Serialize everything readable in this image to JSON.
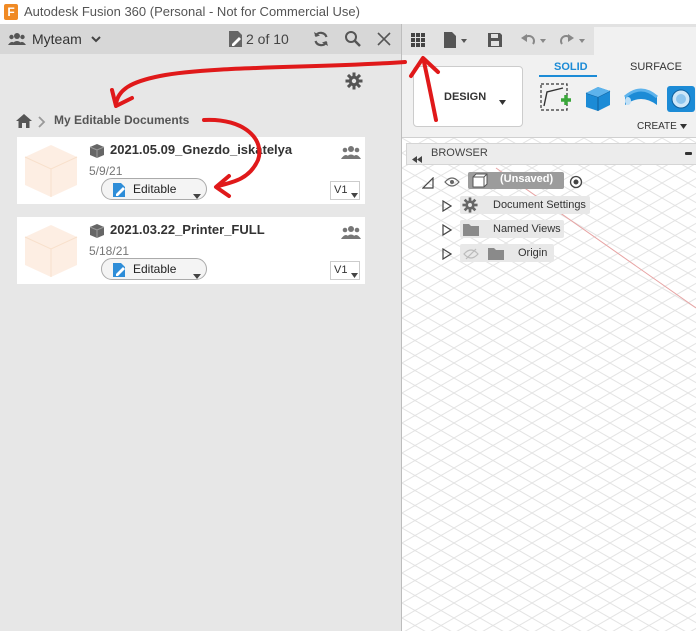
{
  "window": {
    "logo_letter": "F",
    "title": "Autodesk Fusion 360 (Personal - Not for Commercial Use)"
  },
  "data_panel": {
    "team_name": "Myteam",
    "page_count": "2 of 10",
    "breadcrumb": "My Editable Documents",
    "documents": [
      {
        "name": "2021.05.09_Gnezdo_iskatelya",
        "date": "5/9/21",
        "status": "Editable",
        "version": "V1"
      },
      {
        "name": "2021.03.22_Printer_FULL",
        "date": "5/18/21",
        "status": "Editable",
        "version": "V1"
      }
    ]
  },
  "workspace": {
    "design_label": "DESIGN",
    "tabs": [
      "SOLID",
      "SURFACE"
    ],
    "create_label": "CREATE",
    "browser": {
      "title": "BROWSER",
      "root": "(Unsaved)",
      "items": [
        "Document Settings",
        "Named Views",
        "Origin"
      ]
    }
  },
  "colors": {
    "accent_blue": "#1c8bd6",
    "annotation_red": "#e0191a",
    "logo_orange": "#f08a24"
  },
  "icons": [
    "team-icon",
    "chevron-down-icon",
    "document-icon",
    "refresh-icon",
    "search-icon",
    "close-icon",
    "gear-icon",
    "home-icon",
    "cube-icon",
    "members-icon",
    "pencil-icon",
    "grid-icon",
    "save-icon",
    "undo-icon",
    "redo-icon",
    "sketch-icon",
    "extrude-icon",
    "revolve-icon",
    "eye-icon",
    "folder-icon",
    "radio-icon"
  ]
}
